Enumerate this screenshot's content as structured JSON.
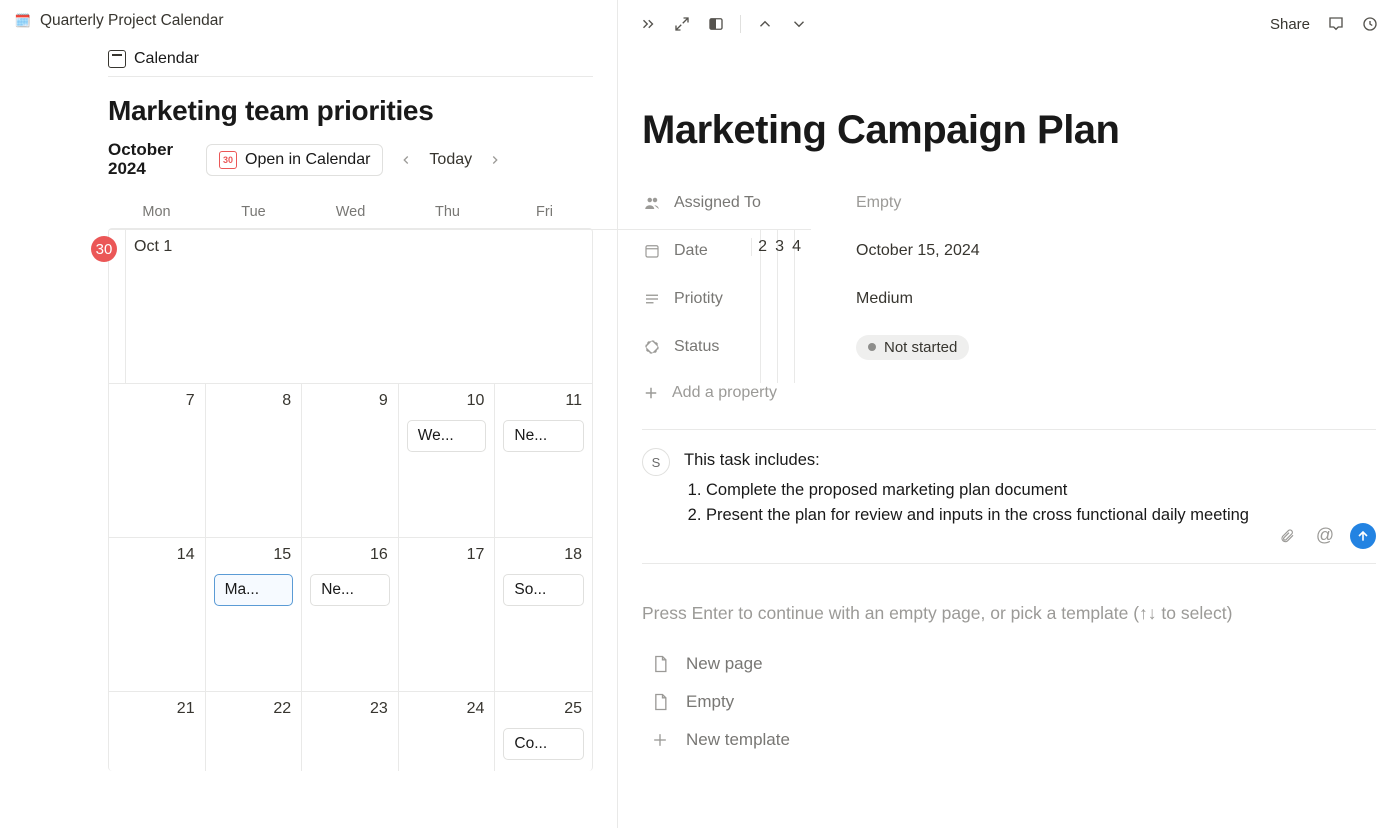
{
  "header": {
    "page_icon": "🗓️",
    "page_title": "Quarterly Project Calendar"
  },
  "calendar": {
    "view_tab": "Calendar",
    "section_title": "Marketing team priorities",
    "month_label": "October 2024",
    "open_in_calendar": "Open in Calendar",
    "open_icon_text": "30",
    "today": "Today",
    "day_headers": [
      "Mon",
      "Tue",
      "Wed",
      "Thu",
      "Fri"
    ],
    "weeks": [
      {
        "cells": [
          {
            "num": "30",
            "prev": true,
            "label": ""
          },
          {
            "num": "Oct 1",
            "label": "",
            "lead": true
          },
          {
            "num": "2"
          },
          {
            "num": "3"
          },
          {
            "num": "4"
          }
        ]
      },
      {
        "cells": [
          {
            "num": "7"
          },
          {
            "num": "8"
          },
          {
            "num": "9"
          },
          {
            "num": "10",
            "event": "We..."
          },
          {
            "num": "11",
            "event": "Ne..."
          }
        ]
      },
      {
        "cells": [
          {
            "num": "14"
          },
          {
            "num": "15",
            "event": "Ma...",
            "selected": true
          },
          {
            "num": "16",
            "event": "Ne..."
          },
          {
            "num": "17"
          },
          {
            "num": "18",
            "event": "So..."
          }
        ]
      },
      {
        "cells": [
          {
            "num": "21"
          },
          {
            "num": "22"
          },
          {
            "num": "23"
          },
          {
            "num": "24"
          },
          {
            "num": "25",
            "event": "Co..."
          }
        ]
      }
    ]
  },
  "detail": {
    "toolbar": {
      "share": "Share"
    },
    "title": "Marketing Campaign Plan",
    "props": {
      "assigned_label": "Assigned To",
      "assigned_value": "Empty",
      "date_label": "Date",
      "date_value": "October 15, 2024",
      "priority_label": "Priotity",
      "priority_value": "Medium",
      "status_label": "Status",
      "status_value": "Not started",
      "add_property": "Add a property"
    },
    "comment": {
      "avatar": "S",
      "lead": "This task includes:",
      "item1": "Complete the proposed marketing plan document",
      "item2": "Present the plan for review and inputs in the cross functional daily meeting"
    },
    "placeholder": "Press Enter to continue with an empty page, or pick a template (↑↓ to select)",
    "templates": {
      "new_page": "New page",
      "empty": "Empty",
      "new_template": "New template"
    }
  }
}
